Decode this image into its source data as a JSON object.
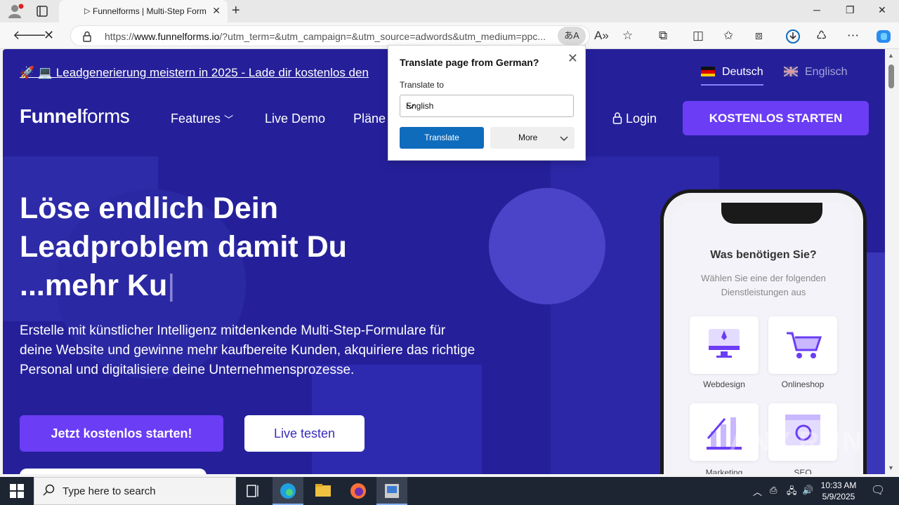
{
  "browser": {
    "tab_title": "Funnelforms | Multi-Step Form",
    "tab_favicon": "▷",
    "url_prefix": "https://",
    "url_domain": "www.funnelforms.io",
    "url_rest": "/?utm_term=&utm_campaign=&utm_source=adwords&utm_medium=ppc..."
  },
  "page": {
    "announcement": "🚀 💻 Leadgenerierung meistern in 2025 - Lade dir kostenlos den",
    "lang_de": "Deutsch",
    "lang_en": "Englisch",
    "logo_bold": "Funnel",
    "logo_rest": "forms",
    "menu": {
      "features": "Features",
      "live_demo": "Live Demo",
      "plans": "Pläne"
    },
    "login": "Login",
    "cta_top": "KOSTENLOS STARTEN",
    "hero_line1": "Löse endlich Dein",
    "hero_line2": "Leadproblem damit Du",
    "hero_line3": "...mehr Ku",
    "sub_line1": "Erstelle mit künstlicher Intelligenz mitdenkende Multi-Step-Formulare für",
    "sub_line2": "deine Website und gewinne mehr kaufbereite Kunden, akquiriere das richtige",
    "sub_line3": "Personal und digitalisiere deine Unternehmensprozesse.",
    "btn_primary": "Jetzt kostenlos starten!",
    "btn_secondary": "Live testen"
  },
  "phone": {
    "title": "Was benötigen Sie?",
    "sub_line1": "Wählen Sie eine der folgenden",
    "sub_line2": "Dienstleistungen aus",
    "cards": [
      "Webdesign",
      "Onlineshop",
      "Marketing",
      "SEO"
    ]
  },
  "translate_popup": {
    "title": "Translate page from German?",
    "label": "Translate to",
    "selected": "English",
    "translate_btn": "Translate",
    "more_btn": "More"
  },
  "taskbar": {
    "search_placeholder": "Type here to search",
    "time": "10:33 AM",
    "date": "5/9/2025"
  },
  "watermark": "ANY.RUN",
  "colors": {
    "page_bg": "#25209a",
    "accent": "#6b3df5",
    "translate_blue": "#0f6cbd"
  }
}
